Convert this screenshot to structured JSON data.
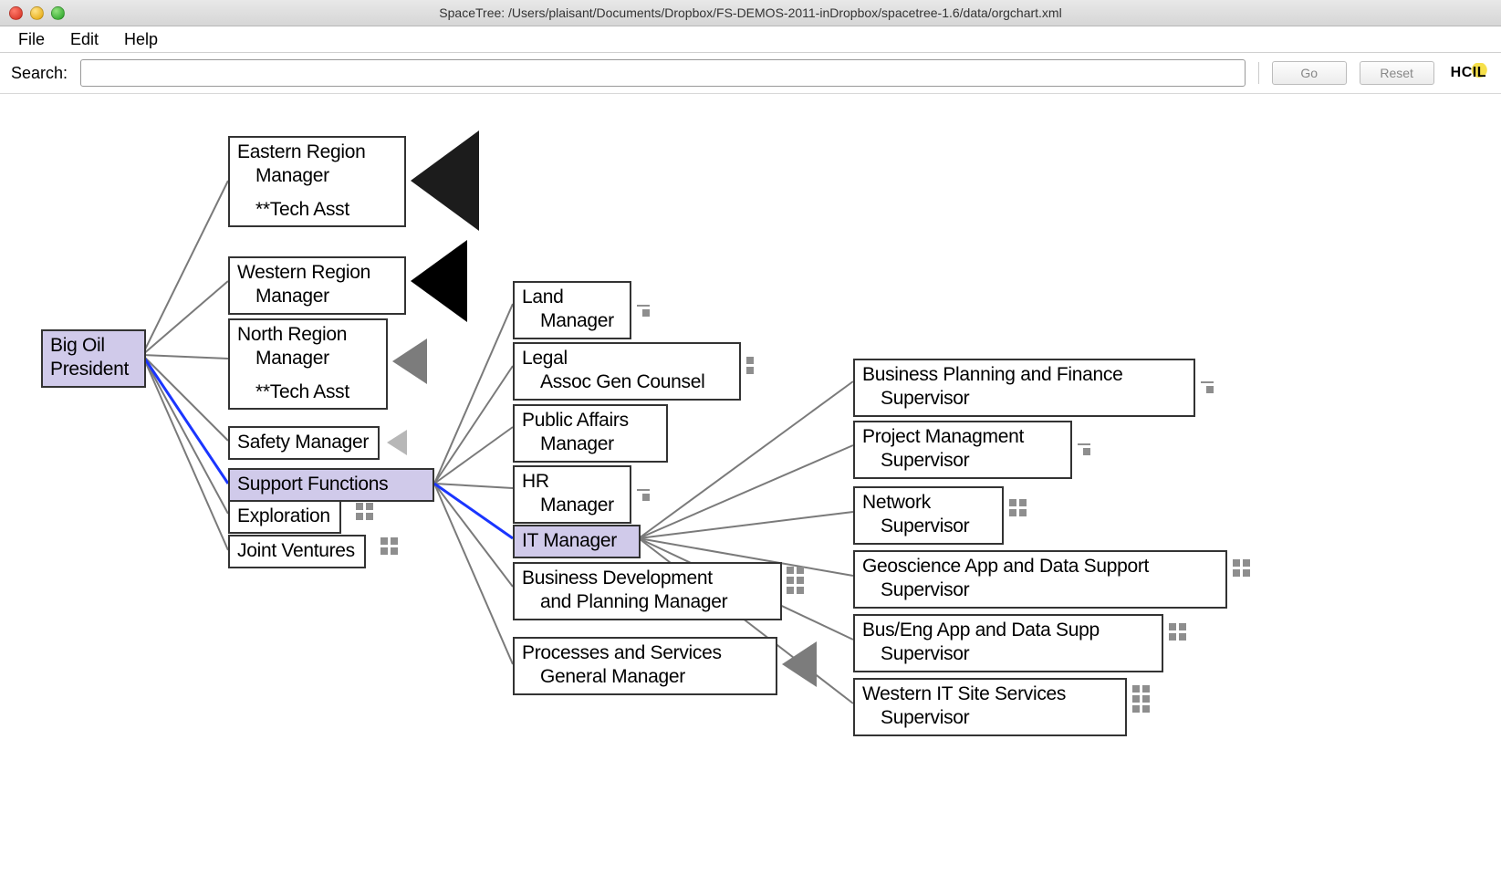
{
  "window": {
    "title": "SpaceTree: /Users/plaisant/Documents/Dropbox/FS-DEMOS-2011-inDropbox/spacetree-1.6/data/orgchart.xml"
  },
  "menu": {
    "file": "File",
    "edit": "Edit",
    "help": "Help"
  },
  "search": {
    "label": "Search:",
    "value": "",
    "go": "Go",
    "reset": "Reset"
  },
  "logo": {
    "text": "HCIL"
  },
  "nodes": {
    "root": {
      "line1": "Big Oil",
      "line2": "President"
    },
    "east": {
      "line1": "Eastern Region",
      "line2": "Manager",
      "line3": "**Tech Asst"
    },
    "west": {
      "line1": "Western Region",
      "line2": "Manager"
    },
    "north": {
      "line1": "North Region",
      "line2": "Manager",
      "line3": "**Tech Asst"
    },
    "safety": {
      "line1": "Safety Manager"
    },
    "support": {
      "line1": "Support Functions"
    },
    "explore": {
      "line1": "Exploration"
    },
    "joint": {
      "line1": "Joint Ventures"
    },
    "land": {
      "line1": "Land",
      "line2": "Manager"
    },
    "legal": {
      "line1": "Legal",
      "line2": "Assoc Gen Counsel"
    },
    "public": {
      "line1": "Public Affairs",
      "line2": "Manager"
    },
    "hr": {
      "line1": "HR",
      "line2": "Manager"
    },
    "it": {
      "line1": "IT Manager"
    },
    "bizdev": {
      "line1": "Business Development",
      "line2": "and Planning Manager"
    },
    "proc": {
      "line1": "Processes and Services",
      "line2": "General Manager"
    },
    "bpf": {
      "line1": "Business Planning and Finance",
      "line2": "Supervisor"
    },
    "projm": {
      "line1": "Project Managment",
      "line2": "Supervisor"
    },
    "net": {
      "line1": "Network",
      "line2": "Supervisor"
    },
    "geo": {
      "line1": "Geoscience App and Data Support",
      "line2": "Supervisor"
    },
    "beng": {
      "line1": "Bus/Eng App and Data Supp",
      "line2": "Supervisor"
    },
    "wits": {
      "line1": "Western IT Site Services",
      "line2": "Supervisor"
    }
  }
}
